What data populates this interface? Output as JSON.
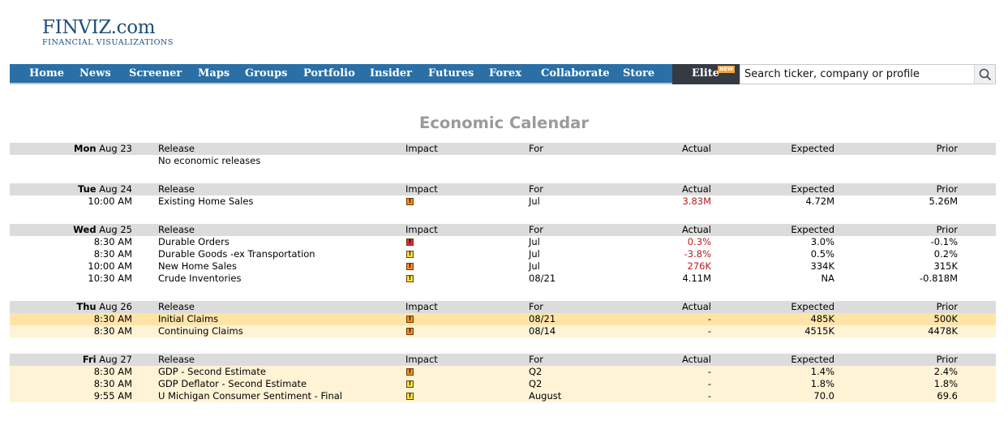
{
  "logo": {
    "title": "FINVIZ.com",
    "subtitle": "FINANCIAL VISUALIZATIONS"
  },
  "nav": {
    "items": [
      "Home",
      "News",
      "Screener",
      "Maps",
      "Groups",
      "Portfolio",
      "Insider",
      "Futures",
      "Forex",
      "Collaborate",
      "Store"
    ],
    "elite_label": "Elite",
    "elite_badge": "NEW",
    "search_placeholder": "Search ticker, company or profile"
  },
  "page_title": "Economic Calendar",
  "columns": {
    "release": "Release",
    "impact": "Impact",
    "for": "For",
    "actual": "Actual",
    "expected": "Expected",
    "prior": "Prior"
  },
  "colors": {
    "nav_bg": "#2a6fa5",
    "elite_bg": "#363a42",
    "badge": "#f3a63f",
    "negative": "#b71c1c",
    "highlight_current": "#ffe4a8",
    "highlight_upcoming": "#fff3d5",
    "impact_high": "#e3263c",
    "impact_medium": "#f58a2a",
    "impact_low": "#f7e03f"
  },
  "days": [
    {
      "weekday": "Mon",
      "date": "Aug 23",
      "note": "No economic releases",
      "events": []
    },
    {
      "weekday": "Tue",
      "date": "Aug 24",
      "events": [
        {
          "time": "10:00 AM",
          "release": "Existing Home Sales",
          "impact": "medium",
          "impact_glyph": "!",
          "for": "Jul",
          "actual": "3.83M",
          "actual_negative": true,
          "expected": "4.72M",
          "prior": "5.26M",
          "highlight": ""
        }
      ]
    },
    {
      "weekday": "Wed",
      "date": "Aug 25",
      "events": [
        {
          "time": "8:30 AM",
          "release": "Durable Orders",
          "impact": "high",
          "impact_glyph": "!",
          "for": "Jul",
          "actual": "0.3%",
          "actual_negative": true,
          "expected": "3.0%",
          "prior": "-0.1%",
          "highlight": ""
        },
        {
          "time": "8:30 AM",
          "release": "Durable Goods -ex Transportation",
          "impact": "low",
          "impact_glyph": "!",
          "for": "Jul",
          "actual": "-3.8%",
          "actual_negative": true,
          "expected": "0.5%",
          "prior": "0.2%",
          "highlight": ""
        },
        {
          "time": "10:00 AM",
          "release": "New Home Sales",
          "impact": "medium",
          "impact_glyph": "!",
          "for": "Jul",
          "actual": "276K",
          "actual_negative": true,
          "expected": "334K",
          "prior": "315K",
          "highlight": ""
        },
        {
          "time": "10:30 AM",
          "release": "Crude Inventories",
          "impact": "low",
          "impact_glyph": "!",
          "for": "08/21",
          "actual": "4.11M",
          "actual_negative": false,
          "expected": "NA",
          "prior": "-0.818M",
          "highlight": ""
        }
      ]
    },
    {
      "weekday": "Thu",
      "date": "Aug 26",
      "events": [
        {
          "time": "8:30 AM",
          "release": "Initial Claims",
          "impact": "medium",
          "impact_glyph": "!",
          "for": "08/21",
          "actual": "-",
          "actual_negative": false,
          "expected": "485K",
          "prior": "500K",
          "highlight": "hl1"
        },
        {
          "time": "8:30 AM",
          "release": "Continuing Claims",
          "impact": "medium",
          "impact_glyph": "!",
          "for": "08/14",
          "actual": "-",
          "actual_negative": false,
          "expected": "4515K",
          "prior": "4478K",
          "highlight": "hl2"
        }
      ]
    },
    {
      "weekday": "Fri",
      "date": "Aug 27",
      "events": [
        {
          "time": "8:30 AM",
          "release": "GDP - Second Estimate",
          "impact": "medium",
          "impact_glyph": "!",
          "for": "Q2",
          "actual": "-",
          "actual_negative": false,
          "expected": "1.4%",
          "prior": "2.4%",
          "highlight": "hl2"
        },
        {
          "time": "8:30 AM",
          "release": "GDP Deflator - Second Estimate",
          "impact": "low",
          "impact_glyph": "!",
          "for": "Q2",
          "actual": "-",
          "actual_negative": false,
          "expected": "1.8%",
          "prior": "1.8%",
          "highlight": "hl2"
        },
        {
          "time": "9:55 AM",
          "release": "U Michigan Consumer Sentiment - Final",
          "impact": "low",
          "impact_glyph": "!",
          "for": "August",
          "actual": "-",
          "actual_negative": false,
          "expected": "70.0",
          "prior": "69.6",
          "highlight": "hl2"
        }
      ]
    }
  ]
}
